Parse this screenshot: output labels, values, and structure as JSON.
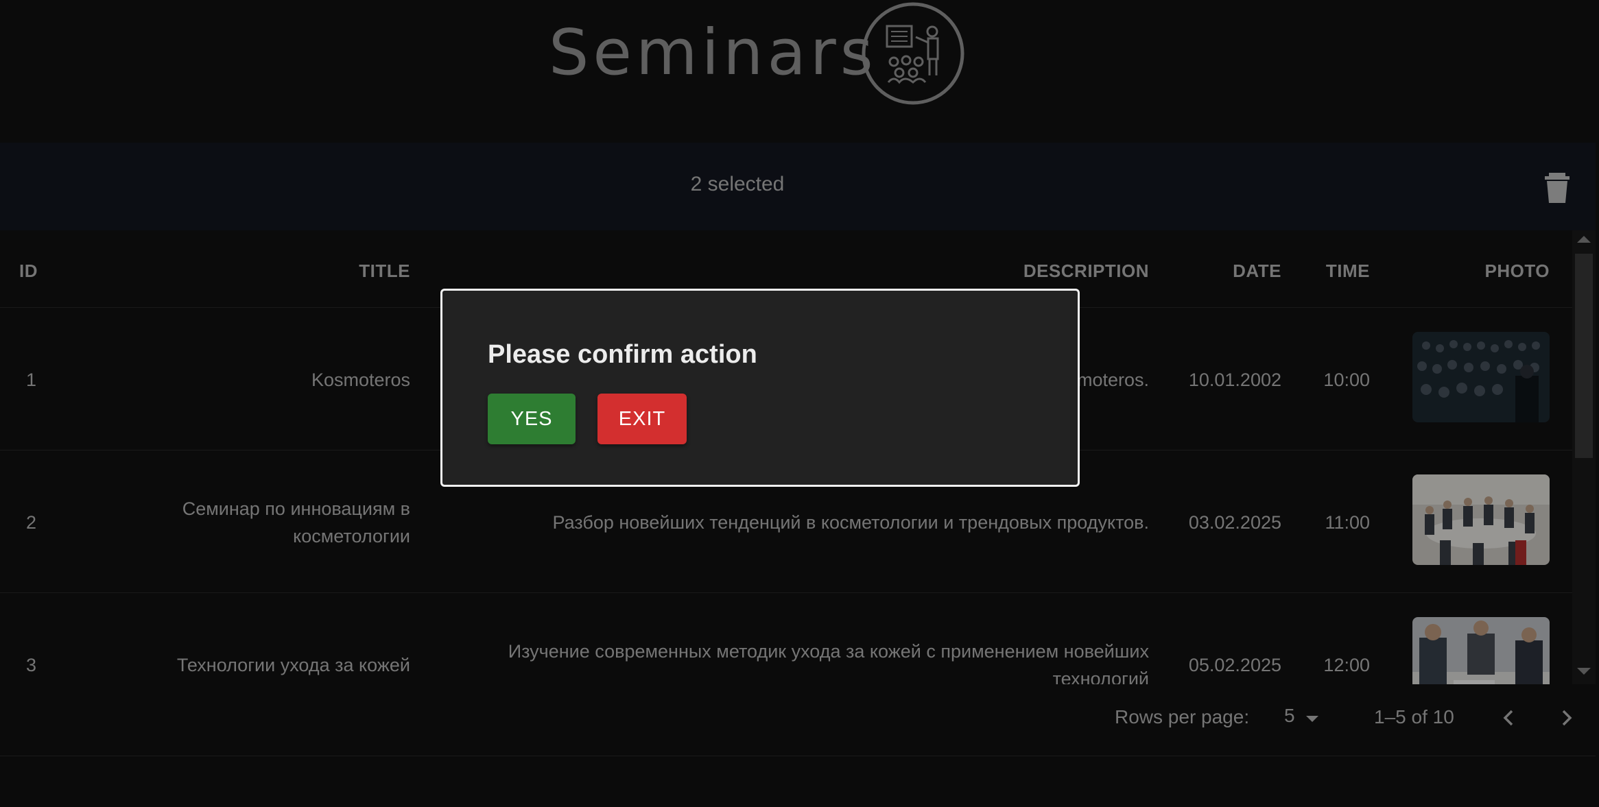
{
  "header": {
    "title": "Seminars",
    "logo_icon": "seminar-presentation-icon"
  },
  "toolbar": {
    "selected_text": "2 selected",
    "delete_icon": "trash-icon"
  },
  "table": {
    "columns": [
      "ID",
      "TITLE",
      "DESCRIPTION",
      "DATE",
      "TIME",
      "PHOTO"
    ],
    "rows": [
      {
        "id": "1",
        "title": "Kosmoteros",
        "description": "moteros.",
        "date": "10.01.2002",
        "time": "10:00"
      },
      {
        "id": "2",
        "title": "Семинар по инновациям в косметологии",
        "description": "Разбор новейших тенденций в косметологии и трендовых продуктов.",
        "date": "03.02.2025",
        "time": "11:00"
      },
      {
        "id": "3",
        "title": "Технологии ухода за кожей",
        "description": "Изучение современных методик ухода за кожей с применением новейших технологий",
        "date": "05.02.2025",
        "time": "12:00"
      }
    ]
  },
  "pagination": {
    "rows_per_page_label": "Rows per page:",
    "rows_per_page_value": "5",
    "range_text": "1–5 of 10"
  },
  "dialog": {
    "title": "Please confirm action",
    "yes_label": "YES",
    "exit_label": "EXIT"
  },
  "colors": {
    "yes": "#2e7d32",
    "exit": "#d32f2f",
    "toolbar": "#141821",
    "background": "#121212"
  }
}
